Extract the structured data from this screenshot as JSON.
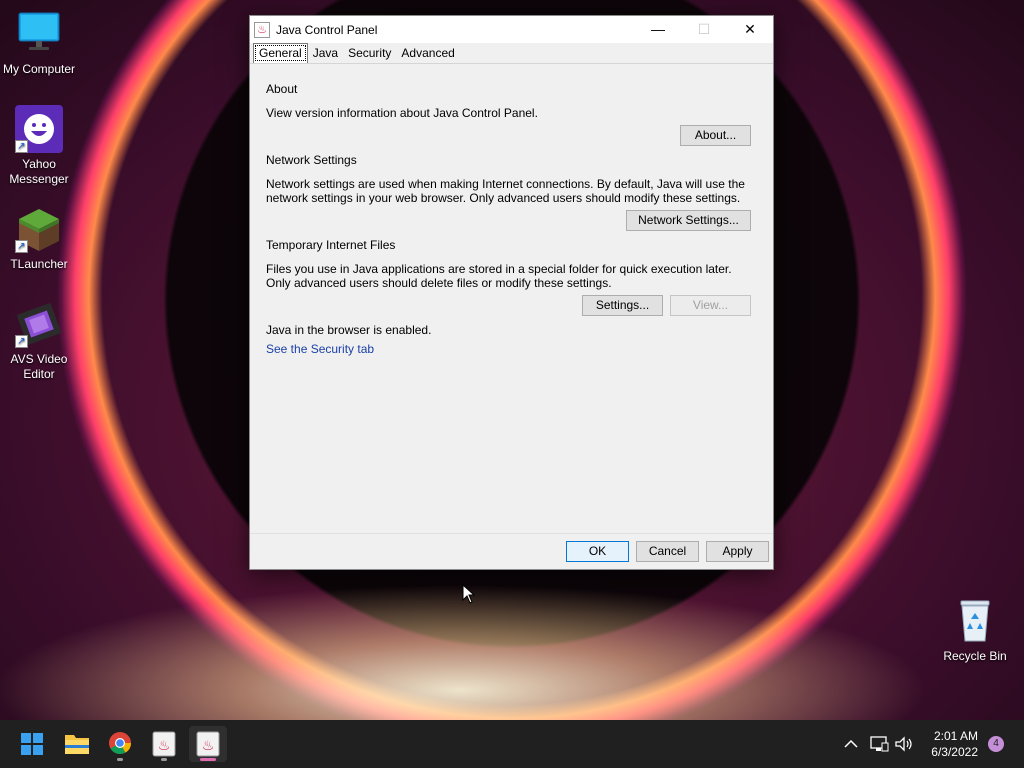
{
  "desktop": {
    "icons": [
      {
        "label": "My Computer"
      },
      {
        "label": "Yahoo\nMessenger"
      },
      {
        "label": "TLauncher"
      },
      {
        "label": "AVS Video\nEditor"
      },
      {
        "label": "Recycle Bin"
      }
    ]
  },
  "window": {
    "title": "Java Control Panel",
    "tabs": [
      "General",
      "Java",
      "Security",
      "Advanced"
    ],
    "active_tab": "General",
    "sections": {
      "about_title": "About",
      "about_text": "View version information about Java Control Panel.",
      "about_button": "About...",
      "network_title": "Network Settings",
      "network_text": "Network settings are used when making Internet connections. By default, Java will use the network settings in your web browser. Only advanced users should modify these settings.",
      "network_button": "Network Settings...",
      "temp_title": "Temporary Internet Files",
      "temp_text": "Files you use in Java applications are stored in a special folder for quick execution later. Only advanced users should delete files or modify these settings.",
      "settings_button": "Settings...",
      "view_button": "View...",
      "browser_status": "Java in the browser is enabled.",
      "security_link": "See the Security tab"
    },
    "footer": {
      "ok": "OK",
      "cancel": "Cancel",
      "apply": "Apply"
    }
  },
  "taskbar": {
    "time": "2:01 AM",
    "date": "6/3/2022",
    "notification_count": "4"
  },
  "colors": {
    "accent": "#0078d7",
    "link": "#1a3fa6",
    "taskbar": "#202020"
  }
}
